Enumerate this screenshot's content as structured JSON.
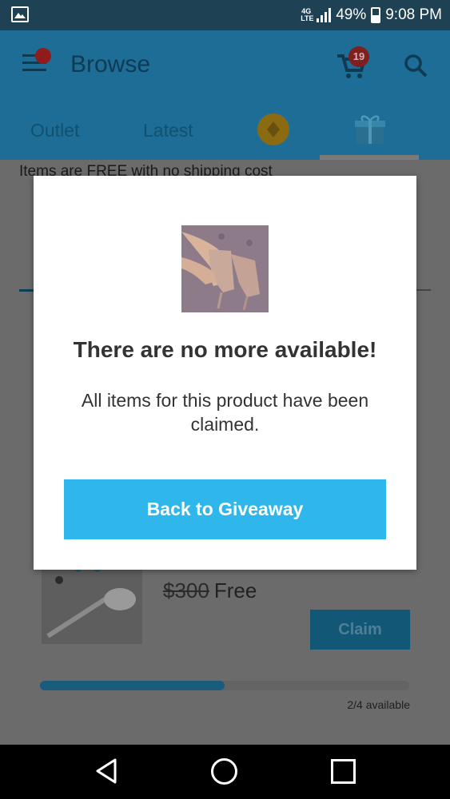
{
  "status_bar": {
    "network": "4G LTE",
    "battery": "49%",
    "time": "9:08 PM"
  },
  "app_bar": {
    "title": "Browse",
    "cart_count": "19"
  },
  "tabs": [
    {
      "label": "Outlet"
    },
    {
      "label": "Latest"
    }
  ],
  "content": {
    "subtext": "Items are FREE with no shipping cost",
    "product": {
      "old_price": "$300",
      "price": "Free",
      "claim_label": "Claim",
      "progress": 0.5,
      "availability": "2/4 available"
    }
  },
  "dialog": {
    "title": "There are no more available!",
    "message": "All items for this product have been claimed.",
    "button_label": "Back to Giveaway"
  },
  "colors": {
    "primary": "#1d6d97",
    "dialog_button": "#2fb6ea"
  }
}
